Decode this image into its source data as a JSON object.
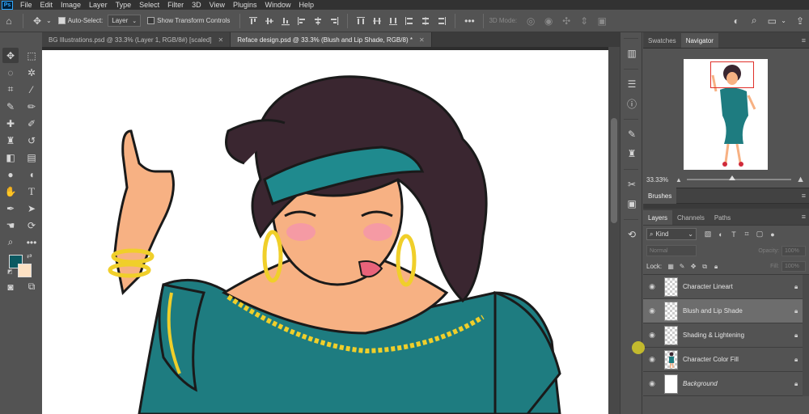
{
  "app": {
    "logo": "Ps"
  },
  "menu": [
    "File",
    "Edit",
    "Image",
    "Layer",
    "Type",
    "Select",
    "Filter",
    "3D",
    "View",
    "Plugins",
    "Window",
    "Help"
  ],
  "options": {
    "auto_select_label": "Auto-Select:",
    "auto_select_checked": true,
    "auto_select_target": "Layer",
    "transform_label": "Show Transform Controls",
    "transform_checked": false,
    "mode_3d_label": "3D Mode:"
  },
  "tabs": [
    {
      "label": "BG Illustrations.psd @ 33.3% (Layer 1, RGB/8#) [scaled]",
      "active": false
    },
    {
      "label": "Reface design.psd @ 33.3% (Blush and Lip Shade, RGB/8) *",
      "active": true
    }
  ],
  "tool_colors": {
    "foreground": "#0b5961",
    "background": "#fde1c3"
  },
  "navigator": {
    "tabs": [
      "Swatches",
      "Navigator"
    ],
    "active_tab": "Navigator",
    "zoom": "33.33%"
  },
  "brushes": {
    "label": "Brushes"
  },
  "layers_panel": {
    "tabs": [
      "Layers",
      "Channels",
      "Paths"
    ],
    "active_tab": "Layers",
    "filter_kind": "Kind",
    "blend_mode": "Normal",
    "opacity_label": "Opacity:",
    "opacity_value": "100%",
    "lock_label": "Lock:",
    "fill_label": "Fill:",
    "fill_value": "100%",
    "layers": [
      {
        "name": "Character Lineart",
        "selected": false,
        "thumb": "transparent",
        "italic": false
      },
      {
        "name": "Blush and Lip Shade",
        "selected": true,
        "thumb": "transparent",
        "italic": false
      },
      {
        "name": "Shading & Lightening",
        "selected": false,
        "thumb": "transparent",
        "italic": false
      },
      {
        "name": "Character Color Fill",
        "selected": false,
        "thumb": "figure",
        "italic": false
      },
      {
        "name": "Background",
        "selected": false,
        "thumb": "white",
        "italic": true
      }
    ]
  },
  "colors": {
    "teal_dress": "#1e7c80",
    "skin": "#f7b183",
    "hair": "#3a2630",
    "gold": "#f0cf2a",
    "blush": "#f59aa4"
  }
}
